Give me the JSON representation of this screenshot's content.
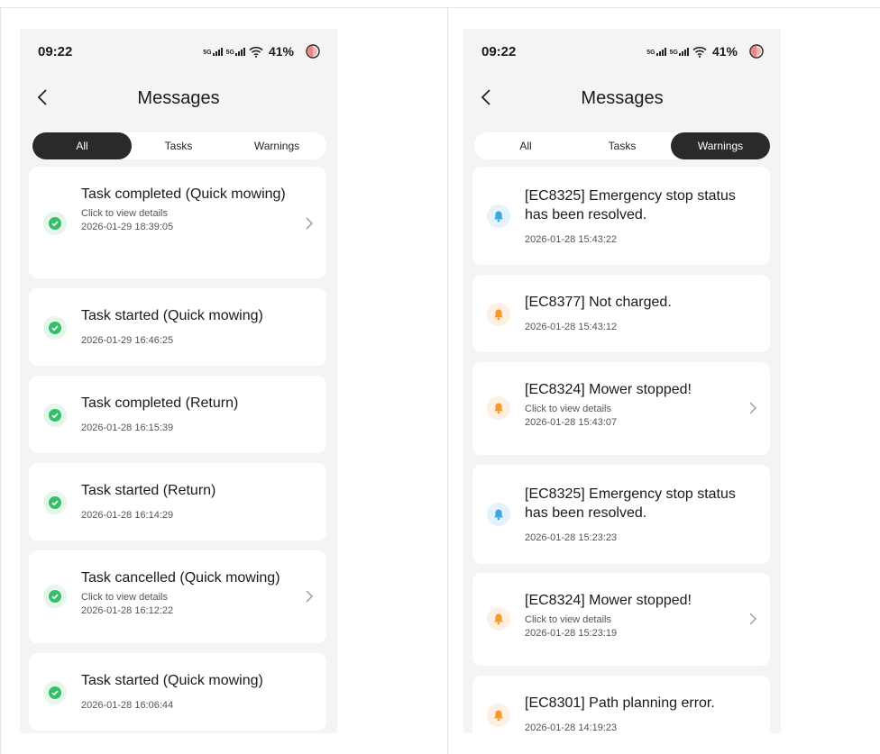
{
  "colors": {
    "success": "#34c06a",
    "info": "#3aa6e6",
    "warning": "#f59a2a",
    "tab_active_bg": "#2a2a2a",
    "screen_bg": "#f4f4f4"
  },
  "screens": [
    {
      "status": {
        "time": "09:22",
        "network1": "5G",
        "network2": "5G",
        "battery": "41%"
      },
      "title": "Messages",
      "tabs": [
        "All",
        "Tasks",
        "Warnings"
      ],
      "active_tab": "All",
      "items": [
        {
          "title": "Task completed (Quick mowing)",
          "subtitle": "Click to view details",
          "date": "2026-01-29 18:39:05",
          "icon": "check-circle-icon"
        },
        {
          "title": "Task started (Quick mowing)",
          "date": "2026-01-29 16:46:25",
          "icon": "check-circle-icon"
        },
        {
          "title": "Task completed (Return)",
          "date": "2026-01-28 16:15:39",
          "icon": "check-circle-icon"
        },
        {
          "title": "Task started (Return)",
          "date": "2026-01-28 16:14:29",
          "icon": "check-circle-icon"
        },
        {
          "title": "Task cancelled (Quick mowing)",
          "subtitle": "Click to view details",
          "date": "2026-01-28 16:12:22",
          "icon": "check-circle-icon"
        },
        {
          "title": "Task started (Quick mowing)",
          "date": "2026-01-28 16:06:44",
          "icon": "check-circle-icon"
        }
      ]
    },
    {
      "status": {
        "time": "09:22",
        "network1": "5G",
        "network2": "5G",
        "battery": "41%"
      },
      "title": "Messages",
      "tabs": [
        "All",
        "Tasks",
        "Warnings"
      ],
      "active_tab": "Warnings",
      "items": [
        {
          "title": "[EC8325] Emergency stop status has been resolved.",
          "date": "2026-01-28 15:43:22",
          "icon": "bell-icon",
          "level": "info"
        },
        {
          "title": "[EC8377] Not charged.",
          "date": "2026-01-28 15:43:12",
          "icon": "bell-icon",
          "level": "warning"
        },
        {
          "title": "[EC8324] Mower stopped!",
          "subtitle": "Click to view details",
          "date": "2026-01-28 15:43:07",
          "icon": "bell-icon",
          "level": "warning"
        },
        {
          "title": "[EC8325] Emergency stop status has been resolved.",
          "date": "2026-01-28 15:23:23",
          "icon": "bell-icon",
          "level": "info"
        },
        {
          "title": "[EC8324] Mower stopped!",
          "subtitle": "Click to view details",
          "date": "2026-01-28 15:23:19",
          "icon": "bell-icon",
          "level": "warning"
        },
        {
          "title": "[EC8301] Path planning error.",
          "date": "2026-01-28 14:19:23",
          "icon": "bell-icon",
          "level": "warning"
        }
      ]
    }
  ]
}
